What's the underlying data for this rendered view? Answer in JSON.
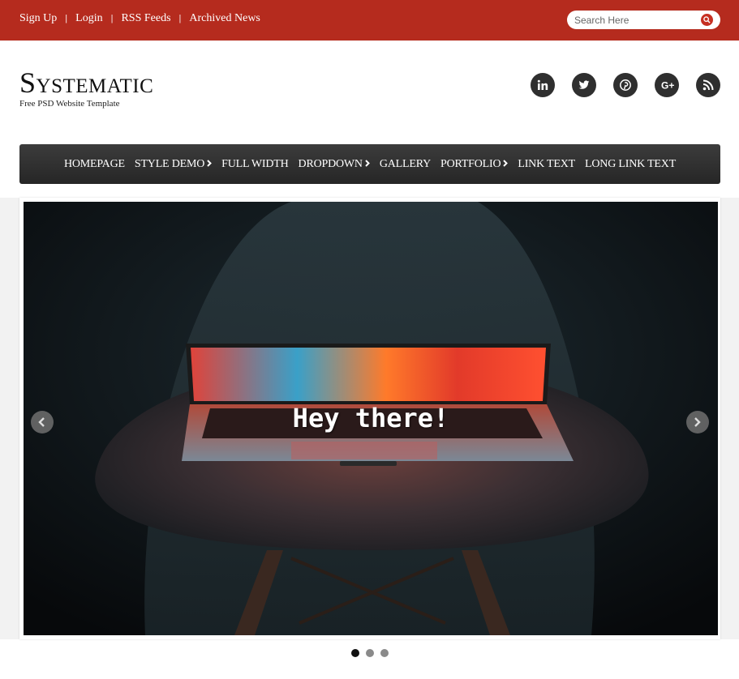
{
  "topbar": {
    "links": [
      "Sign Up",
      "Login",
      "RSS Feeds",
      "Archived News"
    ],
    "search_placeholder": "Search Here",
    "color": "#b52b1e"
  },
  "header": {
    "logo": "Systematic",
    "tagline": "Free PSD Website Template"
  },
  "socials": [
    "linkedin-icon",
    "twitter-icon",
    "pinterest-icon",
    "google-plus-icon",
    "rss-icon"
  ],
  "nav": {
    "items": [
      {
        "label": "HOMEPAGE",
        "has_dropdown": false
      },
      {
        "label": "STYLE DEMO",
        "has_dropdown": true
      },
      {
        "label": "FULL WIDTH",
        "has_dropdown": false
      },
      {
        "label": "DROPDOWN",
        "has_dropdown": true
      },
      {
        "label": "GALLERY",
        "has_dropdown": false
      },
      {
        "label": "PORTFOLIO",
        "has_dropdown": true
      },
      {
        "label": "LINK TEXT",
        "has_dropdown": false
      },
      {
        "label": "LONG LINK TEXT",
        "has_dropdown": false
      }
    ]
  },
  "slider": {
    "caption": "Hey there!",
    "slide_count": 3,
    "active_slide": 1
  }
}
